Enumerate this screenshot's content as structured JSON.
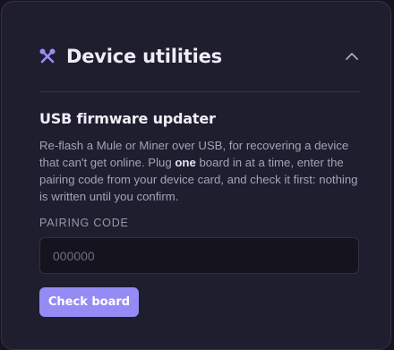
{
  "header": {
    "title": "Device utilities",
    "icon": "tools-icon",
    "collapse_icon": "chevron-up-icon"
  },
  "updater": {
    "title": "USB firmware updater",
    "description_before": "Re-flash a Mule or Miner over USB, for recovering a device that can't get online. Plug ",
    "description_emphasis": "one",
    "description_after": " board in at a time, enter the pairing code from your device card, and check it first: nothing is written until you confirm.",
    "pairing_label": "PAIRING CODE",
    "pairing_value": "",
    "pairing_placeholder": "000000",
    "check_button_label": "Check board"
  },
  "colors": {
    "accent": "#958bf4",
    "card_background": "#1f1e2f",
    "page_background": "#16151f"
  }
}
